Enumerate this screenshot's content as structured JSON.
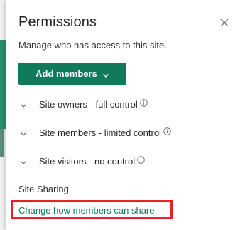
{
  "panel": {
    "title": "Permissions",
    "subtitle": "Manage who has access to this site.",
    "close_icon": "close-icon"
  },
  "add_members": {
    "label": "Add members",
    "icon": "chevron-down-icon",
    "color": "#117a5c"
  },
  "groups": [
    {
      "label": "Site owners - full control",
      "icon": "info-icon"
    },
    {
      "label": "Site members - limited control",
      "icon": "info-icon"
    },
    {
      "label": "Site visitors - no control",
      "icon": "info-icon"
    }
  ],
  "sharing": {
    "heading": "Site Sharing",
    "link_label": "Change how members can share",
    "link_color": "#0e7a5c",
    "highlight_color": "#e8202a"
  }
}
